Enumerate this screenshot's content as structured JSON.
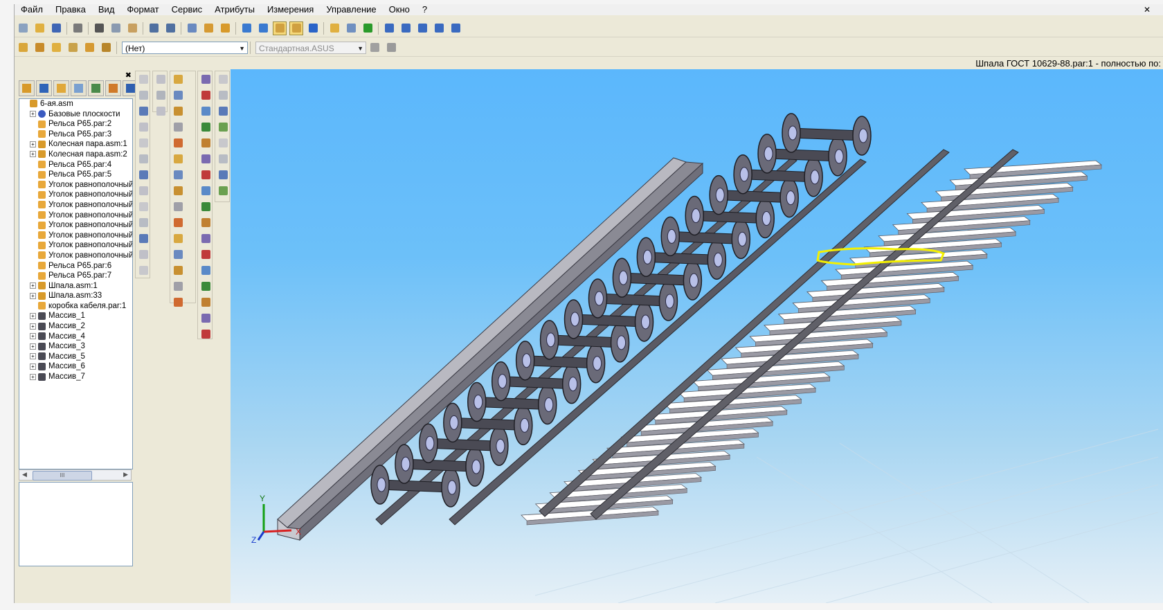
{
  "menu": [
    "Файл",
    "Правка",
    "Вид",
    "Формат",
    "Сервис",
    "Атрибуты",
    "Измерения",
    "Управление",
    "Окно",
    "?"
  ],
  "toolbar": {
    "layer_combo": "(Нет)",
    "style_combo": "Стандартная.ASUS"
  },
  "status_text": "Шпала ГОСТ 10629-88.par:1 - полностью по:",
  "tree": [
    {
      "label": "6-ая.asm",
      "expand": "none",
      "icon": "assembly-icon",
      "indent": 0
    },
    {
      "label": "Базовые плоскости",
      "expand": "+",
      "icon": "planes-icon",
      "indent": 1
    },
    {
      "label": "Рельса Р65.par:2",
      "expand": "none",
      "icon": "part-icon",
      "indent": 1
    },
    {
      "label": "Рельса Р65.par:3",
      "expand": "none",
      "icon": "part-icon",
      "indent": 1
    },
    {
      "label": "Колесная пара.asm:1",
      "expand": "+",
      "icon": "assembly-icon",
      "indent": 1
    },
    {
      "label": "Колесная пара.asm:2",
      "expand": "+",
      "icon": "assembly-icon",
      "indent": 1
    },
    {
      "label": "Рельса Р65.par:4",
      "expand": "none",
      "icon": "part-icon",
      "indent": 1
    },
    {
      "label": "Рельса Р65.par:5",
      "expand": "none",
      "icon": "part-icon",
      "indent": 1
    },
    {
      "label": "Уголок равнополочный",
      "expand": "none",
      "icon": "part-icon",
      "indent": 1
    },
    {
      "label": "Уголок равнополочный",
      "expand": "none",
      "icon": "part-icon",
      "indent": 1
    },
    {
      "label": "Уголок равнополочный",
      "expand": "none",
      "icon": "part-icon",
      "indent": 1
    },
    {
      "label": "Уголок равнополочный",
      "expand": "none",
      "icon": "part-icon",
      "indent": 1
    },
    {
      "label": "Уголок равнополочный",
      "expand": "none",
      "icon": "part-icon",
      "indent": 1
    },
    {
      "label": "Уголок равнополочный",
      "expand": "none",
      "icon": "part-icon",
      "indent": 1
    },
    {
      "label": "Уголок равнополочный",
      "expand": "none",
      "icon": "part-icon",
      "indent": 1
    },
    {
      "label": "Уголок равнополочный",
      "expand": "none",
      "icon": "part-icon",
      "indent": 1
    },
    {
      "label": "Рельса Р65.par:6",
      "expand": "none",
      "icon": "part-icon",
      "indent": 1
    },
    {
      "label": "Рельса Р65.par:7",
      "expand": "none",
      "icon": "part-icon",
      "indent": 1
    },
    {
      "label": "Шпала.asm:1",
      "expand": "+",
      "icon": "assembly-icon",
      "indent": 1
    },
    {
      "label": "Шпала.asm:33",
      "expand": "+",
      "icon": "assembly-icon",
      "indent": 1
    },
    {
      "label": "коробка кабеля.par:1",
      "expand": "none",
      "icon": "part-icon",
      "indent": 1
    },
    {
      "label": "Массив_1",
      "expand": "+",
      "icon": "pattern-icon",
      "indent": 1
    },
    {
      "label": "Массив_2",
      "expand": "+",
      "icon": "pattern-icon",
      "indent": 1
    },
    {
      "label": "Массив_4",
      "expand": "+",
      "icon": "pattern-icon",
      "indent": 1
    },
    {
      "label": "Массив_3",
      "expand": "+",
      "icon": "pattern-icon",
      "indent": 1
    },
    {
      "label": "Массив_5",
      "expand": "+",
      "icon": "pattern-icon",
      "indent": 1
    },
    {
      "label": "Массив_6",
      "expand": "+",
      "icon": "pattern-icon",
      "indent": 1
    },
    {
      "label": "Массив_7",
      "expand": "+",
      "icon": "pattern-icon",
      "indent": 1
    }
  ],
  "scroll_thumb_text": "III",
  "axes": {
    "x": "X",
    "y": "Y",
    "z": "Z"
  },
  "colors": {
    "viewport_top": "#5bb7fc",
    "selection": "#f4f000",
    "steel": "#9b9ba3",
    "wheel_dark": "#3a3a44"
  }
}
